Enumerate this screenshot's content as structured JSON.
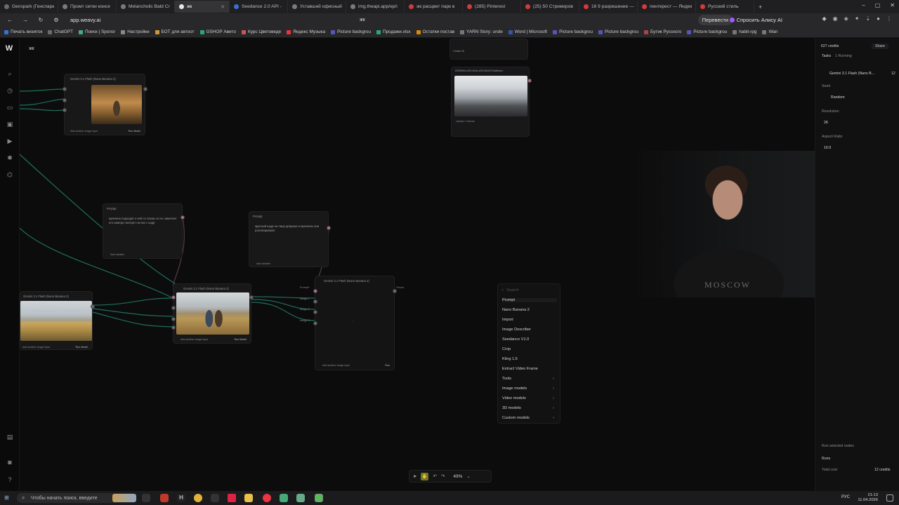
{
  "browser": {
    "tabs": [
      {
        "label": "Genspark (Генспарк",
        "color": "#6b6b6b",
        "active": false
      },
      {
        "label": "Промт сетки консе",
        "color": "#7a7a7a",
        "active": false
      },
      {
        "label": "Melancholic Bald Cr",
        "color": "#7a7a7a",
        "active": false
      },
      {
        "label": "жк",
        "color": "#e6e6e6",
        "active": true
      },
      {
        "label": "Seedance 2.0 API - ",
        "color": "#3b6fd1",
        "active": false
      },
      {
        "label": "Уставший офисный",
        "color": "#7a7a7a",
        "active": false
      },
      {
        "label": "img.theapi.app/ep/i",
        "color": "#7a7a7a",
        "active": false
      },
      {
        "label": "жк расцвет парк в ",
        "color": "#d13b3b",
        "active": false
      },
      {
        "label": "(285) Pinterest",
        "color": "#d13b3b",
        "active": false
      },
      {
        "label": "(25) 50 Стримеров",
        "color": "#d13b3b",
        "active": false
      },
      {
        "label": "16 9 разрешение —",
        "color": "#d13b3b",
        "active": false
      },
      {
        "label": "пинтерест — Яндек",
        "color": "#d13b3b",
        "active": false
      },
      {
        "label": "Русский стиль",
        "color": "#d13b3b",
        "active": false
      }
    ],
    "url": "app.weavy.ai",
    "page_title": "жк",
    "translate_label": "Перевести",
    "alice_label": "Спросить Алису AI",
    "bookmarks": [
      "Печать визиток",
      "ChatGPT",
      "Поиск | Sponsr",
      "Настройки",
      "БОТ для автоот",
      "GSHOP Авито",
      "Курс Цветоведе",
      "Яндекс Музыка",
      "Picture backgrou",
      "Продажи.xlsx",
      "Остатки постав",
      "YARN Story: unde",
      "Word | Microsoft",
      "Picture backgrou",
      "Picture backgrou",
      "Бутик Русского",
      "Picture backgrou",
      "habit-rpg",
      "Wan"
    ]
  },
  "app": {
    "project_name": "жк",
    "nodes": {
      "top_left": {
        "title": "Gemini 3.1 Flash (Nano Banana 2)",
        "footer": "Add another image input",
        "run": "Run Model"
      },
      "top_right": {
        "id_text": "6026f9bd-e2f3-4b4d-af76-6544704a8bcdn...",
        "sub": "Create  16",
        "footer": "Upload / Canvas"
      },
      "prompt_left": {
        "title": "Prompt",
        "text": "мужчина подходит к ней со спины он не замечает его камера смотрит на них с кадр",
        "footer": "Add variable"
      },
      "prompt_mid": {
        "title": "Prompt",
        "text": "крупный кадр на лица девушки и мужчины они разговаривают",
        "footer": "Add variable"
      },
      "bottom_left": {
        "title": "Gemini 3.1 Flash (Nano Banana 2)",
        "footer": "Add another image input",
        "run": "Run Model"
      },
      "bottom_mid": {
        "title": "Gemini 3.1 Flash (Nano Banana 2)",
        "footer": "Add another image input",
        "run": "Run Model"
      },
      "bottom_empty": {
        "title": "Gemini 3.1 Flash (Nano Banana 2)",
        "footer": "Add another image input",
        "run": "Run",
        "prompt_tag": "Prompt*",
        "result_tag": "Result",
        "inputs": [
          "Image 1",
          "Image 2",
          "Image 3"
        ]
      }
    },
    "context_menu": {
      "search_placeholder": "Search",
      "items": [
        {
          "label": "Prompt",
          "has_sub": false
        },
        {
          "label": "Nano Banana 2",
          "has_sub": false
        },
        {
          "label": "Import",
          "has_sub": false
        },
        {
          "label": "Image Describer",
          "has_sub": false
        },
        {
          "label": "Seedance V1.0",
          "has_sub": false
        },
        {
          "label": "Crop",
          "has_sub": false
        },
        {
          "label": "Kling 1.6",
          "has_sub": false
        },
        {
          "label": "Extract Video Frame",
          "has_sub": false
        },
        {
          "label": "Tools",
          "has_sub": true
        },
        {
          "label": "Image models",
          "has_sub": true
        },
        {
          "label": "Video models",
          "has_sub": true
        },
        {
          "label": "3D models",
          "has_sub": true
        },
        {
          "label": "Custom models",
          "has_sub": true
        }
      ]
    },
    "right_panel": {
      "credits": "627 credits",
      "share": "Share",
      "tasks": "Tasks",
      "tasks_running": "1 Running",
      "model": "Gemini 3.1 Flash (Nano B...",
      "model_count": "12",
      "seed_label": "Seed",
      "seed_value": "Random",
      "resolution_label": "Resolution",
      "resolution_value": "2K",
      "aspect_label": "Aspect Ratio",
      "aspect_value": "16:9",
      "run_selected": "Run selected nodes",
      "runs_label": "Runs",
      "total_cost_label": "Total cost",
      "total_cost_value": "12 credits"
    },
    "toolbar": {
      "zoom": "49%"
    },
    "webcam": {
      "shirt_text": "MOSCOW"
    }
  },
  "taskbar": {
    "search_placeholder": "Чтобы начать поиск, введите",
    "language": "РУС",
    "time": "21:13",
    "date": "11.04.2026"
  },
  "colors": {
    "wire": "#1f6e5a",
    "accent_hand": "#6c7a2d",
    "port_pink": "#b56d8f"
  }
}
